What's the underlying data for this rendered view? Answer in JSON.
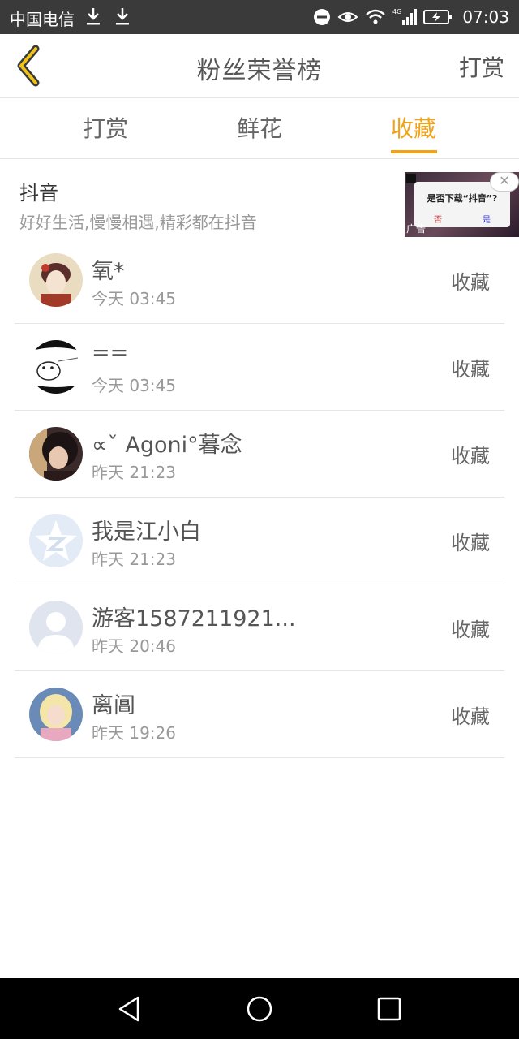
{
  "status_bar": {
    "carrier": "中国电信",
    "time": "07:03",
    "network": "4G"
  },
  "header": {
    "title": "粉丝荣誉榜",
    "action": "打赏"
  },
  "tabs": [
    {
      "label": "打赏",
      "active": false
    },
    {
      "label": "鲜花",
      "active": false
    },
    {
      "label": "收藏",
      "active": true
    }
  ],
  "ad": {
    "title": "抖音",
    "subtitle": "好好生活,慢慢相遇,精彩都在抖音",
    "dialog_text": "是否下载“抖音”?",
    "no_label": "否",
    "yes_label": "是",
    "ad_label": "广告",
    "close_label": "✕"
  },
  "rows": [
    {
      "name": "氧*",
      "time": "今天 03:45",
      "action": "收藏"
    },
    {
      "name": "==",
      "time": "今天 03:45",
      "action": "收藏"
    },
    {
      "name": "∝ˇ Agoni°暮念",
      "time": "昨天 21:23",
      "action": "收藏"
    },
    {
      "name": "我是江小白",
      "time": "昨天 21:23",
      "action": "收藏"
    },
    {
      "name": "游客1587211921...",
      "time": "昨天 20:46",
      "action": "收藏"
    },
    {
      "name": "离阊",
      "time": "昨天 19:26",
      "action": "收藏"
    }
  ],
  "colors": {
    "accent": "#f0a318",
    "status_bar": "#3a3a3a",
    "nav_bar": "#000000"
  },
  "icons": [
    "download-icon",
    "dnd-icon",
    "eye-icon",
    "wifi-icon",
    "signal-icon",
    "battery-icon",
    "back-icon",
    "nav-back-icon",
    "nav-home-icon",
    "nav-recents-icon"
  ]
}
